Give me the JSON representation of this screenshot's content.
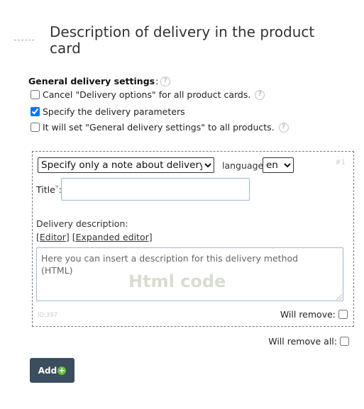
{
  "page": {
    "title": "Description of delivery in the product card"
  },
  "general": {
    "label": "General delivery settings",
    "colon": ":",
    "help_icon": "question-circle-icon",
    "options": [
      {
        "label": "Cancel \"Delivery options\" for all product cards.",
        "checked": false,
        "has_help": true
      },
      {
        "label": "Specify the delivery parameters",
        "checked": true,
        "has_help": false
      },
      {
        "label": "It will set \"General delivery settings\" to all products.",
        "checked": false,
        "has_help": true
      }
    ]
  },
  "delivery_item": {
    "number": "#1",
    "type_select": {
      "value": "Specify only a note about delivery"
    },
    "language_label": "language",
    "language_select": {
      "value": "en"
    },
    "title_label": "Title",
    "title_required": "*",
    "title_colon": ":",
    "title_value": "",
    "description_label": "Delivery description:",
    "editor_link": "[Editor]",
    "expanded_editor_link": "[Expanded editor]",
    "description_placeholder": "Here you can insert a description for this delivery method (HTML)",
    "html_watermark": "Html code",
    "small_id": "ID:397",
    "will_remove_label": "Will remove:",
    "will_remove_checked": false
  },
  "footer": {
    "will_remove_all_label": "Will remove all:",
    "will_remove_all_checked": false,
    "add_button_label": "Add",
    "add_icon": "plus-circle-icon",
    "add_icon_color": "#6bbf3a",
    "add_button_color": "#3b4d5e"
  }
}
